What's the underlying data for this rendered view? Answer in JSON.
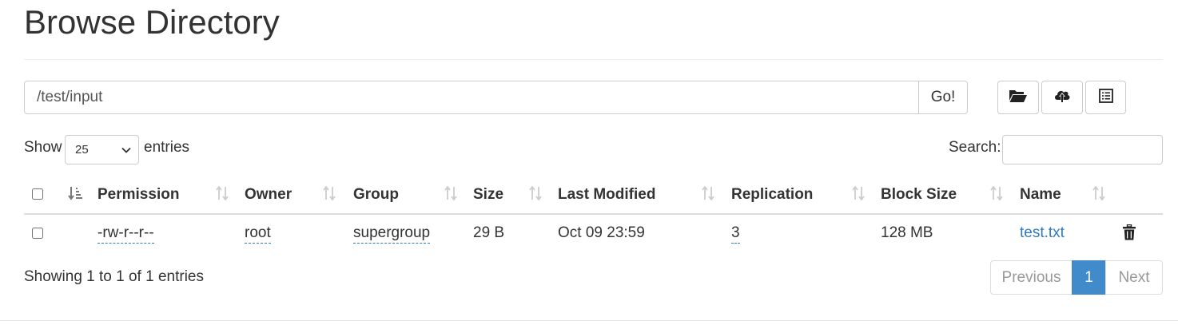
{
  "page": {
    "title": "Browse Directory"
  },
  "toolbar": {
    "path_value": "/test/input",
    "go_label": "Go!",
    "buttons": [
      "folder-open-icon",
      "cloud-upload-icon",
      "list-alt-icon"
    ]
  },
  "length_menu": {
    "show_label": "Show",
    "selected": "25",
    "entries_label": "entries"
  },
  "search": {
    "label": "Search:",
    "value": ""
  },
  "table": {
    "headers": {
      "permission": "Permission",
      "owner": "Owner",
      "group": "Group",
      "size": "Size",
      "last_modified": "Last Modified",
      "replication": "Replication",
      "block_size": "Block Size",
      "name": "Name"
    },
    "rows": [
      {
        "permission": "-rw-r--r--",
        "owner": "root",
        "group": "supergroup",
        "size": "29 B",
        "last_modified": "Oct 09 23:59",
        "replication": "3",
        "block_size": "128 MB",
        "name": "test.txt"
      }
    ]
  },
  "footer": {
    "info": "Showing 1 to 1 of 1 entries"
  },
  "pagination": {
    "previous": "Previous",
    "current": "1",
    "next": "Next"
  },
  "colors": {
    "link": "#2f7bbf",
    "active_page": "#428bca",
    "text": "#333333"
  }
}
